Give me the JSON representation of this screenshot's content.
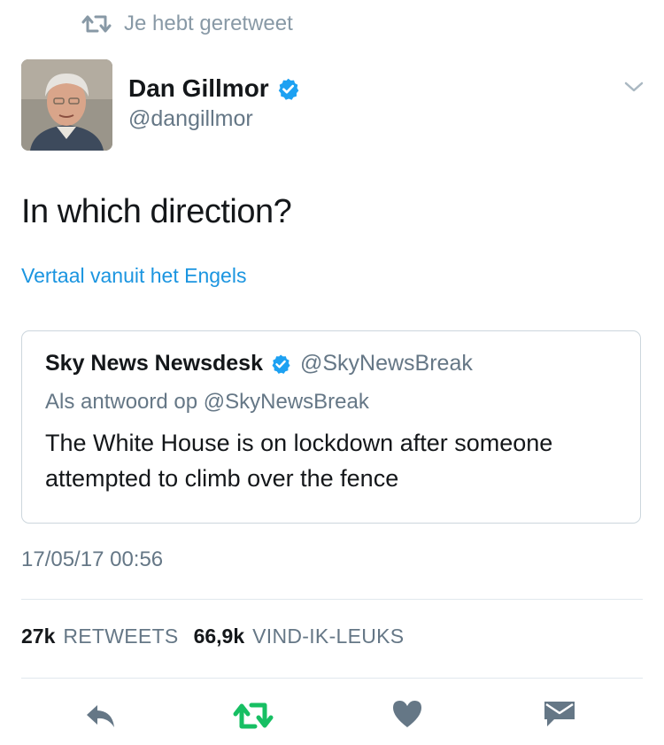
{
  "retweet_context": {
    "label": "Je hebt geretweet",
    "icon": "retweet-icon"
  },
  "author": {
    "name": "Dan Gillmor",
    "handle": "@dangillmor",
    "verified": true
  },
  "tweet": {
    "text": "In which direction?",
    "translate_label": "Vertaal vanuit het Engels"
  },
  "quoted": {
    "name": "Sky News Newsdesk",
    "handle": "@SkyNewsBreak",
    "reply_to": "Als antwoord op @SkyNewsBreak",
    "text": "The White House is on lockdown after someone attempted to climb over the fence"
  },
  "timestamp": "17/05/17 00:56",
  "stats": {
    "retweets_count": "27k",
    "retweets_label": "RETWEETS",
    "likes_count": "66,9k",
    "likes_label": "VIND-IK-LEUKS"
  },
  "actions": {
    "icons": [
      "reply-icon",
      "retweet-icon",
      "like-icon",
      "message-icon"
    ],
    "retweet_active_color": "#17bf63",
    "inactive_color": "#657786"
  },
  "colors": {
    "link": "#1b95e0",
    "verified": "#1da1f2",
    "secondary_text": "#657786",
    "border": "#e1e8ed"
  }
}
